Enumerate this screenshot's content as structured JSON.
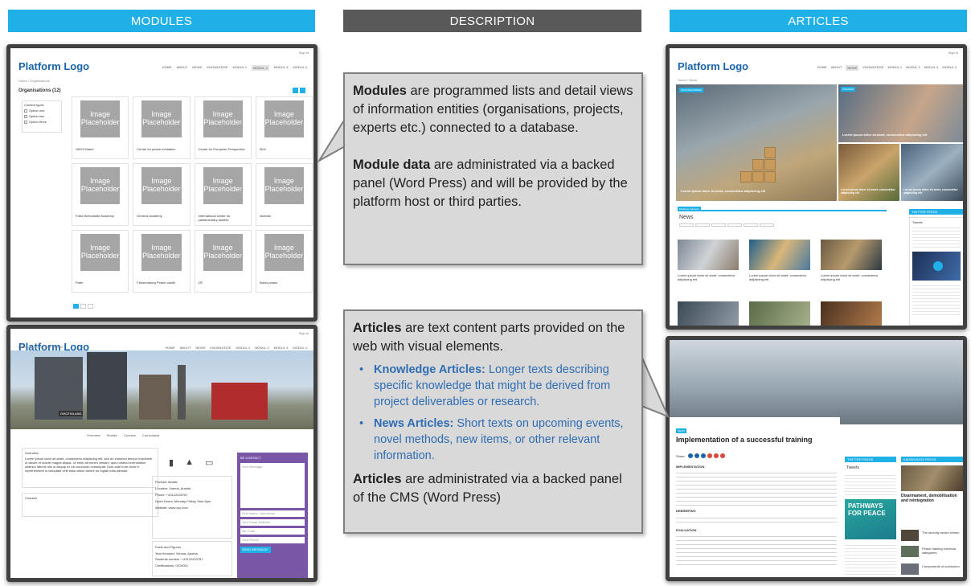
{
  "headers": {
    "modules": "MODULES",
    "description": "DESCRIPTION",
    "articles": "ARTICLES"
  },
  "site": {
    "logo": "Platform Logo",
    "signin": "Sign in",
    "nav": [
      "HOME",
      "ABOUT",
      "NEWS",
      "KNOWLEDGE",
      "MODUL 1",
      "MODUL 2",
      "MODUL 3",
      "MODUL 4"
    ]
  },
  "module_list": {
    "breadcrumb": "Home / Organisations",
    "title": "Organisations (12)",
    "filter_title": "Content types",
    "filter_options": [
      "Option one",
      "Option two",
      "Option three"
    ],
    "placeholder": "Image Placeholder",
    "cards": [
      "OMCFinland",
      "Center for peace mediation",
      "Center for European Perspective",
      "Sinti",
      "Folke Bernadotte Academy",
      "Geneva academy",
      "International center for parliamentary studies",
      "Inmedio",
      "Patrir",
      "Friedensburg Peace castle",
      "ZIF",
      "Swiss peace"
    ]
  },
  "module_detail": {
    "breadcrumb": "Home / Partners / OMCFinland",
    "hero_label": "OMCFINLAND",
    "tabs": [
      "Overview",
      "Studies",
      "Courses",
      "Curriculums"
    ],
    "overview_title": "Overview",
    "overview_text": "Lorem ipsum dolor sit amet, consectetur adipiscing elit, sed do eiusmod tempor incididunt ut labore et dolore magna aliqua. Ut enim ad minim veniam, quis nostrud exercitation ullamco laboris nisi ut aliquip ex ea commodo consequat. Duis aute irure dolor in reprehenderit in voluptate velit esse cillum dolore eu fugiat nulla pariatur.",
    "courses_title": "Courses",
    "provider_title": "Provider details",
    "provider_lines": [
      "Location: Vienna, Austria",
      "Phone: +43122433787",
      "Open Hours: Monday-Friday, 9am-5pm",
      "Website: www.xyz.com"
    ],
    "facts_title": "Facts and Figures",
    "facts_lines": [
      "Year founded: Vienna, Austria",
      "Students number: +43122433787",
      "Certifications: ISO9001"
    ],
    "contact_title": "BE CONTACT",
    "contact_fields": [
      "Your Message",
      "First Name, Last Name",
      "Your Email Address",
      "Zip Code",
      "Your Phone"
    ],
    "contact_button": "SEND MESSAGE"
  },
  "articles_overview": {
    "breadcrumb": "Home / News",
    "hero_tags": [
      "UNCATEGORIZED",
      "TRAINING"
    ],
    "hero_caption": "Lorem ipsum dolor sit amet, consectetur adipiscing elit",
    "small_caption": "Lorem ipsum dolor sit amet, consectetur adipiscing elit",
    "news_kicker": "Breaking Category",
    "news_title": "News",
    "news_captions": [
      "Lorem ipsum dolor sit amet, consectetur adipiscing elit",
      "Lorem ipsum dolor sit amet, consectetur adipiscing elit",
      "Lorem ipsum dolor sit amet, consectetur adipiscing elit"
    ],
    "twitter_head": "TWITTER FEEDS",
    "tweets_label": "Tweets"
  },
  "article_detail": {
    "tag": "NEWS",
    "title": "Implementation of a successful training",
    "share_label": "Share",
    "sections": [
      "IMPLEMENTATION",
      "DEBRIEFING",
      "EVALUATION"
    ],
    "twitter_head": "TWITTER FEEDS",
    "tweets_label": "Tweets",
    "peace_text": "PATHWAYS FOR PEACE",
    "knowledge_head": "KNOWLEDGE FEEDS",
    "knowledge_title": "Disarmament, demobilisation and reintegration",
    "knowledge_items": [
      "The security sector reform",
      "Peace training curricula categories",
      "Components of curriculum"
    ]
  },
  "callouts": {
    "modules": {
      "p1_bold": "Modules",
      "p1_rest": " are programmed lists and detail views of information entities (organisations, projects, experts etc.) connected to a database.",
      "p2_bold": "Module data",
      "p2_rest": " are administrated via a backed panel (Word Press) and will be provided by the platform host or third parties."
    },
    "articles": {
      "p1_bold": "Articles",
      "p1_rest": " are text content parts provided on the web with visual elements.",
      "bullets": [
        {
          "bold": "Knowledge Articles:",
          "rest": " Longer texts describing specific knowledge that might be derived from project deliverables or research."
        },
        {
          "bold": "News Articles:",
          "rest": " Short texts on upcoming events, novel methods, new items, or other relevant information."
        }
      ],
      "p2_bold": "Articles",
      "p2_rest": " are administrated via a backed panel of the CMS (Word Press)"
    }
  },
  "colors": {
    "accent": "#1fb0e8",
    "dark_header": "#595959",
    "callout_bg": "#d9d9d9",
    "bullet_text": "#2f6db3",
    "contact_purple": "#7a56a6"
  }
}
